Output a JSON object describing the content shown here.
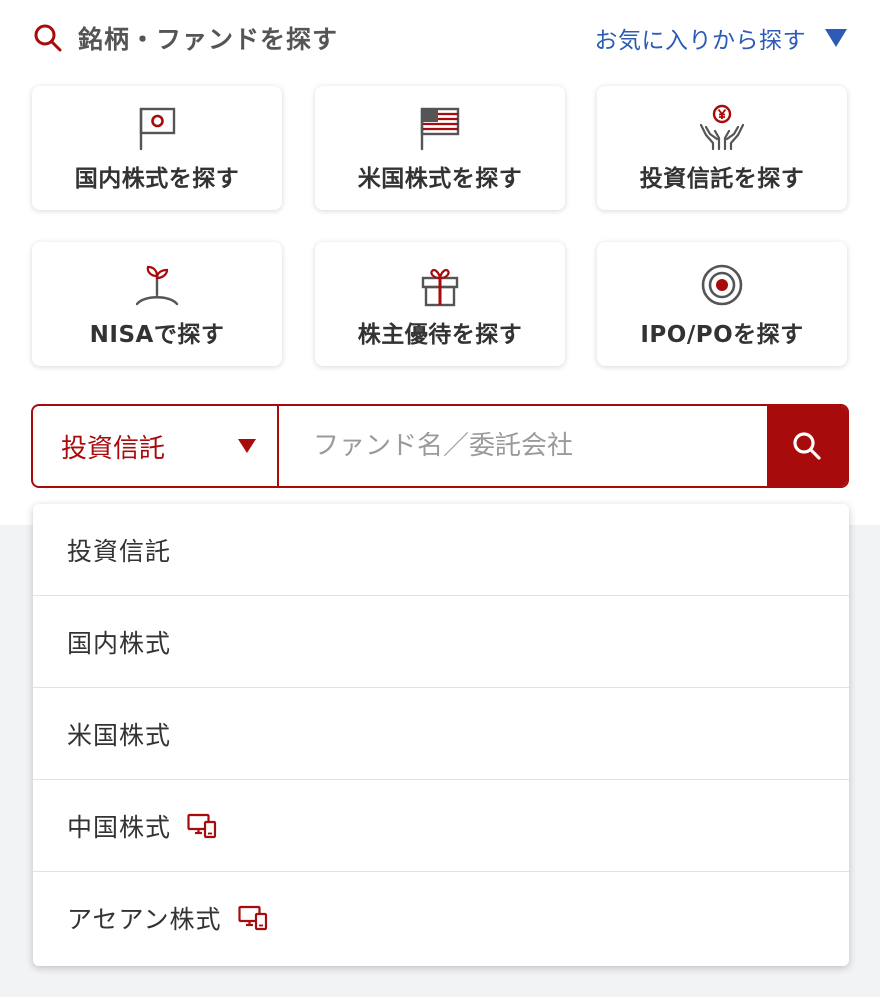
{
  "colors": {
    "brand_red": "#a80b0b",
    "link_blue": "#2c5bb5",
    "text_gray": "#333333"
  },
  "header": {
    "title": "銘柄・ファンドを探す",
    "favorites_link": "お気に入りから探す",
    "search_icon": "search-icon",
    "toggle_icon": "triangle-down-icon"
  },
  "tiles": [
    {
      "label": "国内株式を探す",
      "icon": "japan-flag-icon"
    },
    {
      "label": "米国株式を探す",
      "icon": "us-flag-icon"
    },
    {
      "label": "投資信託を探す",
      "icon": "yen-hands-icon"
    },
    {
      "label": "NISAで探す",
      "icon": "sprout-icon"
    },
    {
      "label": "株主優待を探す",
      "icon": "gift-icon"
    },
    {
      "label": "IPO/POを探す",
      "icon": "target-icon"
    }
  ],
  "search": {
    "category_selected": "投資信託",
    "placeholder": "ファンド名／委託会社",
    "value": "",
    "button_icon": "search-icon"
  },
  "dropdown": {
    "options": [
      {
        "label": "投資信託",
        "icon": ""
      },
      {
        "label": "国内株式",
        "icon": ""
      },
      {
        "label": "米国株式",
        "icon": ""
      },
      {
        "label": "中国株式",
        "icon": "pc-only-icon"
      },
      {
        "label": "アセアン株式",
        "icon": "pc-only-icon"
      }
    ]
  }
}
